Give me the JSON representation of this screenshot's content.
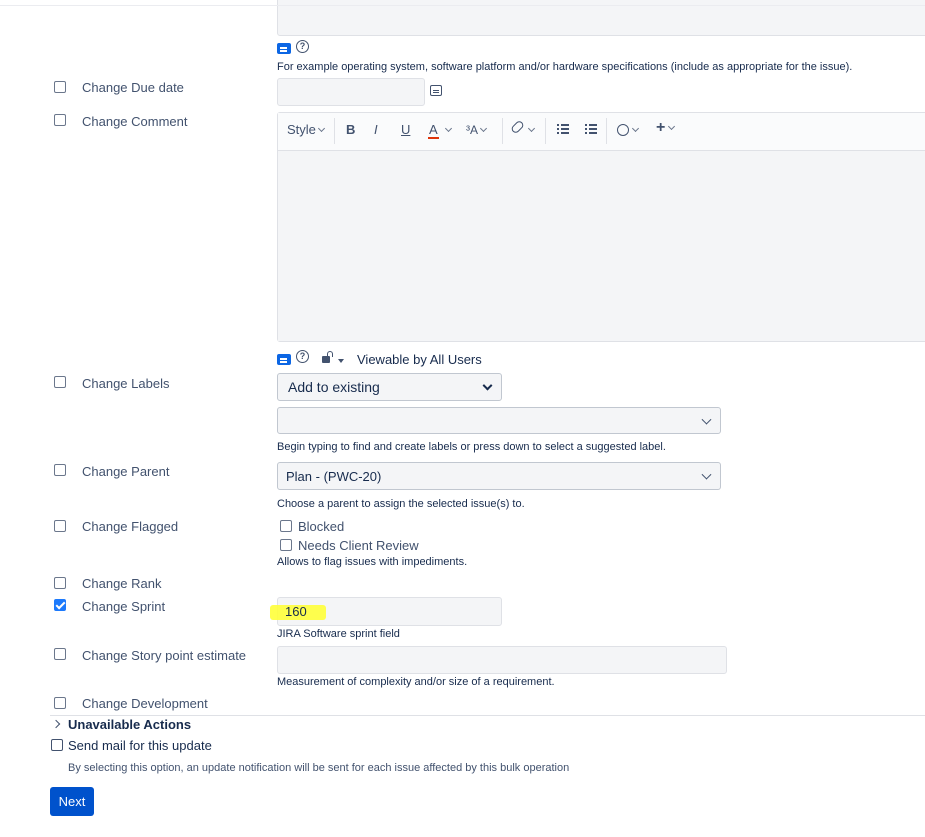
{
  "environment_hint": {
    "label": "For example operating system, software platform and/or hardware specifications (include as appropriate for the issue)."
  },
  "rows": {
    "due_date": {
      "label": "Change Due date"
    },
    "comment": {
      "label": "Change Comment"
    },
    "labels": {
      "label": "Change Labels"
    },
    "parent": {
      "label": "Change Parent"
    },
    "flagged": {
      "label": "Change Flagged"
    },
    "rank": {
      "label": "Change Rank"
    },
    "sprint": {
      "label": "Change Sprint"
    },
    "story_points": {
      "label": "Change Story point estimate"
    },
    "development": {
      "label": "Change Development"
    }
  },
  "editor_toolbar": {
    "style_label": "Style",
    "bold": "B",
    "italic": "I",
    "underline": "U",
    "text_color": "A",
    "font_size": "³A",
    "link": "🔗",
    "bullet": "•≡",
    "numbered": "1≡",
    "emoji": "☺",
    "insert": "+"
  },
  "comment_visibility": {
    "label": "Viewable by All Users"
  },
  "labels_field": {
    "mode_selected": "Add to existing",
    "help": "Begin typing to find and create labels or press down to select a suggested label."
  },
  "parent_field": {
    "selected": "Plan - (PWC-20)",
    "help": "Choose a parent to assign the selected issue(s) to."
  },
  "flagged_field": {
    "options": [
      {
        "label": "Blocked",
        "checked": false
      },
      {
        "label": "Needs Client Review",
        "checked": false
      }
    ],
    "help": "Allows to flag issues with impediments."
  },
  "sprint_field": {
    "value": "160",
    "help": "JIRA Software sprint field"
  },
  "story_points_field": {
    "value": "",
    "help": "Measurement of complexity and/or size of a requirement."
  },
  "unavailable": {
    "label": "Unavailable Actions"
  },
  "send_mail": {
    "label": "Send mail for this update",
    "help": "By selecting this option, an update notification will be sent for each issue affected by this bulk operation"
  },
  "next_button": {
    "label": "Next"
  },
  "colors": {
    "primary": "#0052cc",
    "highlight": "#ffff3a",
    "checkbox_checked": "#1d7afc"
  }
}
